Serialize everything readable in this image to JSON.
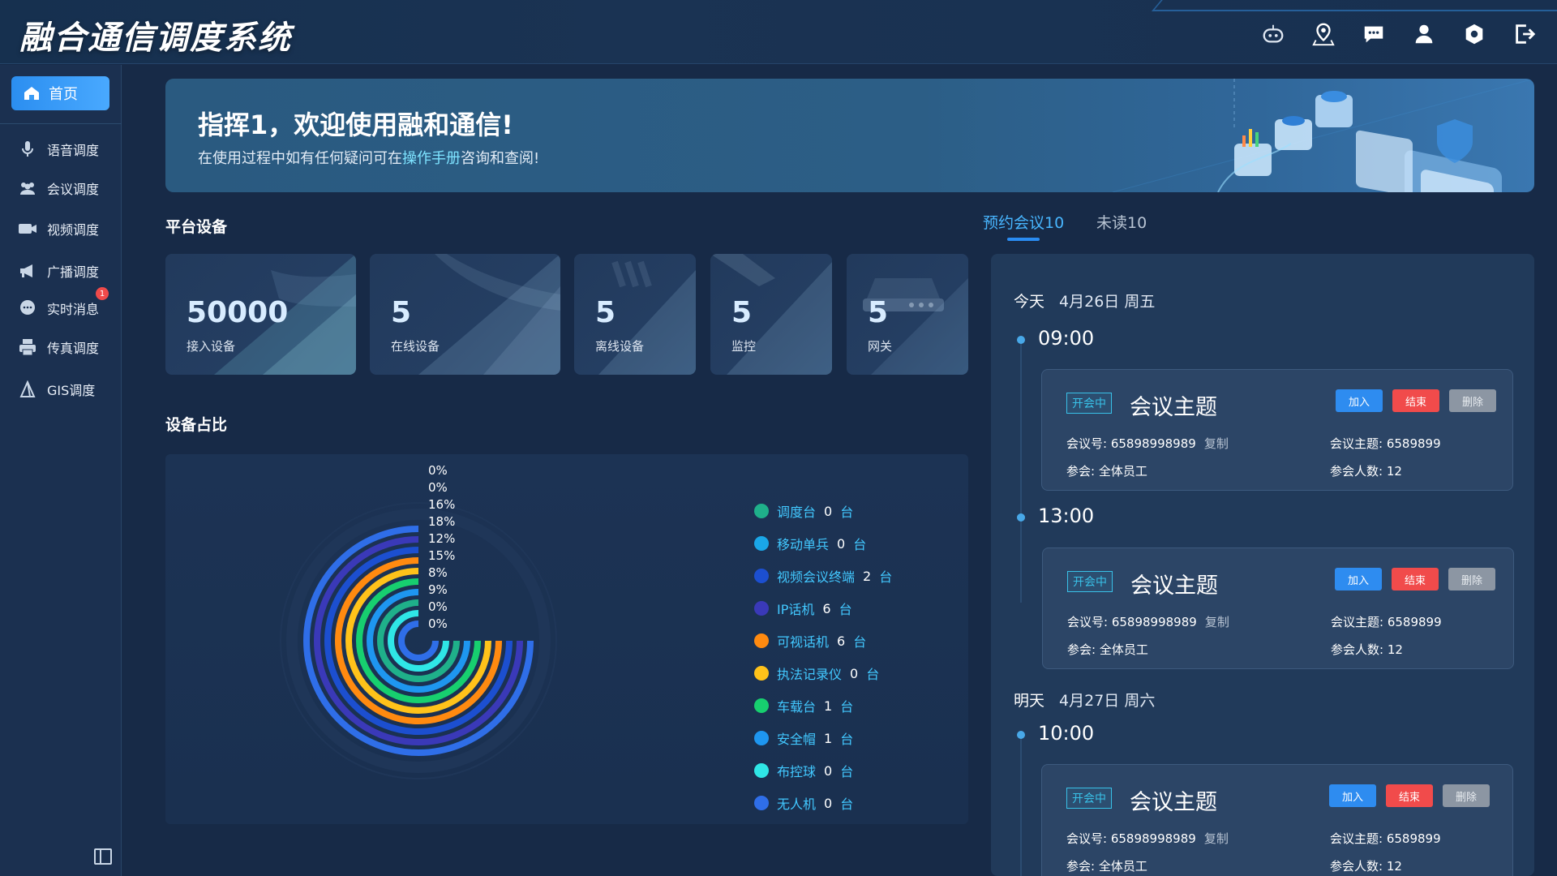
{
  "app": {
    "title": "融合通信调度系统"
  },
  "header_icons": [
    "robot-icon",
    "location-pin-icon",
    "chat-icon",
    "user-icon",
    "settings-icon",
    "logout-icon"
  ],
  "sidebar": {
    "home_label": "首页",
    "items": [
      {
        "label": "语音调度",
        "icon": "microphone-icon"
      },
      {
        "label": "会议调度",
        "icon": "group-icon"
      },
      {
        "label": "视频调度",
        "icon": "video-camera-icon"
      },
      {
        "label": "广播调度",
        "icon": "megaphone-icon"
      },
      {
        "label": "实时消息",
        "icon": "message-icon",
        "badge": "1"
      },
      {
        "label": "传真调度",
        "icon": "fax-icon"
      },
      {
        "label": "GIS调度",
        "icon": "map-icon"
      }
    ]
  },
  "banner": {
    "greeting": "指挥1，欢迎使用融和通信!",
    "sub_before": "在使用过程中如有任何疑问可在",
    "sub_link": "操作手册",
    "sub_after": "咨询和查阅!"
  },
  "platform": {
    "title": "平台设备",
    "cards": [
      {
        "value": "50000",
        "label": "接入设备"
      },
      {
        "value": "5",
        "label": "在线设备"
      },
      {
        "value": "5",
        "label": "离线设备"
      },
      {
        "value": "5",
        "label": "监控"
      },
      {
        "value": "5",
        "label": "网关"
      }
    ]
  },
  "ratio": {
    "title": "设备占比"
  },
  "chart_data": {
    "type": "radial-bar",
    "percent_labels": [
      "0%",
      "0%",
      "16%",
      "18%",
      "12%",
      "15%",
      "8%",
      "9%",
      "0%",
      "0%"
    ],
    "legend": [
      {
        "name": "调度台",
        "count": "0",
        "unit": "台",
        "color": "#1fb08a"
      },
      {
        "name": "移动单兵",
        "count": "0",
        "unit": "台",
        "color": "#1aa7e8"
      },
      {
        "name": "视频会议终端",
        "count": "2",
        "unit": "台",
        "color": "#1c4fd0"
      },
      {
        "name": "IP话机",
        "count": "6",
        "unit": "台",
        "color": "#3a39b8"
      },
      {
        "name": "可视话机",
        "count": "6",
        "unit": "台",
        "color": "#ff8a10"
      },
      {
        "name": "执法记录仪",
        "count": "0",
        "unit": "台",
        "color": "#ffc21a"
      },
      {
        "name": "车载台",
        "count": "1",
        "unit": "台",
        "color": "#17cf6f"
      },
      {
        "name": "安全帽",
        "count": "1",
        "unit": "台",
        "color": "#1e96f0"
      },
      {
        "name": "布控球",
        "count": "0",
        "unit": "台",
        "color": "#2fe6e6"
      },
      {
        "name": "无人机",
        "count": "0",
        "unit": "台",
        "color": "#2f6ee8"
      }
    ]
  },
  "tabs": [
    {
      "label": "预约会议10",
      "active": true
    },
    {
      "label": "未读10",
      "active": false
    }
  ],
  "schedule": {
    "days": [
      {
        "day": "今天",
        "date": "4月26日 周五"
      },
      {
        "day": "明天",
        "date": "4月27日 周六"
      }
    ],
    "meetings": [
      {
        "time": "09:00",
        "status": "开会中",
        "title": "会议主题",
        "join": "加入",
        "end": "结束",
        "del": "删除",
        "id_label": "会议号: 65898998989",
        "copy": "复制",
        "subject_label": "会议主题: 6589899",
        "attendees_label": "参会: 全体员工",
        "count_label": "参会人数: 12"
      },
      {
        "time": "13:00",
        "status": "开会中",
        "title": "会议主题",
        "join": "加入",
        "end": "结束",
        "del": "删除",
        "id_label": "会议号: 65898998989",
        "copy": "复制",
        "subject_label": "会议主题: 6589899",
        "attendees_label": "参会: 全体员工",
        "count_label": "参会人数: 12"
      },
      {
        "time": "10:00",
        "status": "开会中",
        "title": "会议主题",
        "join": "加入",
        "end": "结束",
        "del": "删除",
        "id_label": "会议号: 65898998989",
        "copy": "复制",
        "subject_label": "会议主题: 6589899",
        "attendees_label": "参会: 全体员工",
        "count_label": "参会人数: 12"
      }
    ]
  }
}
